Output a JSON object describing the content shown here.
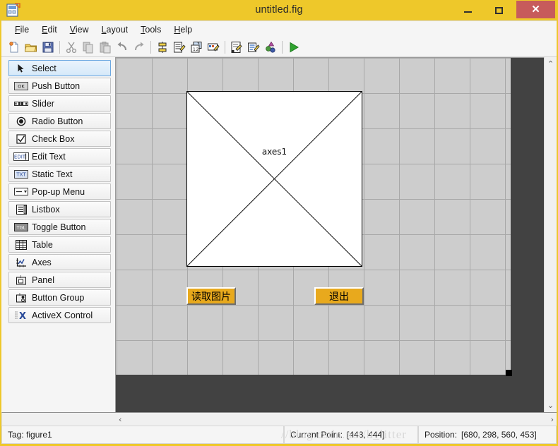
{
  "window": {
    "title": "untitled.fig",
    "app_icon": "guide-figure-icon",
    "minimize_label": "",
    "maximize_label": "",
    "close_label": "✕",
    "titlebar_color": "#eec82a",
    "close_button_color": "#c75b5b"
  },
  "menu": {
    "items": [
      {
        "mnemonic": "F",
        "rest": "ile"
      },
      {
        "mnemonic": "E",
        "rest": "dit"
      },
      {
        "mnemonic": "V",
        "rest": "iew"
      },
      {
        "mnemonic": "L",
        "rest": "ayout"
      },
      {
        "mnemonic": "T",
        "rest": "ools"
      },
      {
        "mnemonic": "H",
        "rest": "elp"
      }
    ]
  },
  "toolbar": {
    "buttons": [
      {
        "name": "new-figure-icon",
        "tip": "New"
      },
      {
        "name": "open-folder-icon",
        "tip": "Open"
      },
      {
        "name": "save-disk-icon",
        "tip": "Save"
      },
      {
        "name": "separator",
        "tip": ""
      },
      {
        "name": "cut-scissors-icon",
        "tip": "Cut"
      },
      {
        "name": "copy-icon",
        "tip": "Copy"
      },
      {
        "name": "paste-icon",
        "tip": "Paste"
      },
      {
        "name": "undo-arrow-icon",
        "tip": "Undo"
      },
      {
        "name": "redo-arrow-icon",
        "tip": "Redo"
      },
      {
        "name": "separator",
        "tip": ""
      },
      {
        "name": "align-objects-icon",
        "tip": "Align Objects"
      },
      {
        "name": "menu-editor-icon",
        "tip": "Menu Editor"
      },
      {
        "name": "tab-order-editor-icon",
        "tip": "Tab Order Editor"
      },
      {
        "name": "toolbar-editor-icon",
        "tip": "Toolbar Editor"
      },
      {
        "name": "separator",
        "tip": ""
      },
      {
        "name": "m-file-editor-icon",
        "tip": "M-file Editor"
      },
      {
        "name": "property-inspector-icon",
        "tip": "Property Inspector"
      },
      {
        "name": "object-browser-icon",
        "tip": "Object Browser"
      },
      {
        "name": "separator",
        "tip": ""
      },
      {
        "name": "run-figure-icon",
        "tip": "Run Figure"
      }
    ]
  },
  "palette": {
    "items": [
      {
        "label": "Select",
        "icon": "cursor-arrow-icon",
        "selected": true
      },
      {
        "label": "Push Button",
        "icon": "push-button-icon",
        "selected": false
      },
      {
        "label": "Slider",
        "icon": "slider-icon",
        "selected": false
      },
      {
        "label": "Radio Button",
        "icon": "radio-button-icon",
        "selected": false
      },
      {
        "label": "Check Box",
        "icon": "check-box-icon",
        "selected": false
      },
      {
        "label": "Edit Text",
        "icon": "edit-text-icon",
        "selected": false
      },
      {
        "label": "Static Text",
        "icon": "static-text-icon",
        "selected": false
      },
      {
        "label": "Pop-up Menu",
        "icon": "popup-menu-icon",
        "selected": false
      },
      {
        "label": "Listbox",
        "icon": "listbox-icon",
        "selected": false
      },
      {
        "label": "Toggle Button",
        "icon": "toggle-button-icon",
        "selected": false
      },
      {
        "label": "Table",
        "icon": "table-icon",
        "selected": false
      },
      {
        "label": "Axes",
        "icon": "axes-icon",
        "selected": false
      },
      {
        "label": "Panel",
        "icon": "panel-icon",
        "selected": false
      },
      {
        "label": "Button Group",
        "icon": "button-group-icon",
        "selected": false
      },
      {
        "label": "ActiveX Control",
        "icon": "activex-control-icon",
        "selected": false
      }
    ]
  },
  "canvas": {
    "axes": {
      "label": "axes1",
      "name": "axes1-placeholder"
    },
    "pushbuttons": [
      {
        "label": "读取图片",
        "name": "read-image-button",
        "color": "#e8a91d"
      },
      {
        "label": "退出",
        "name": "exit-button",
        "color": "#e8a91d"
      }
    ],
    "grid_spacing_px": 50,
    "background_color": "#cdcdcd",
    "outside_color": "#424242"
  },
  "scrollbars": {
    "up_arrow": "⌃",
    "down_arrow": "⌄",
    "left_arrow": "‹",
    "right_arrow": "›"
  },
  "status": {
    "tag": "Tag: figure1",
    "current_point_key": "Current Point:",
    "current_point_value": "[443, 444]",
    "position_key": "Position:",
    "position_value": "[680, 298, 560, 453]"
  },
  "watermark": {
    "text": "//blog.csdn.net/b_litter"
  }
}
